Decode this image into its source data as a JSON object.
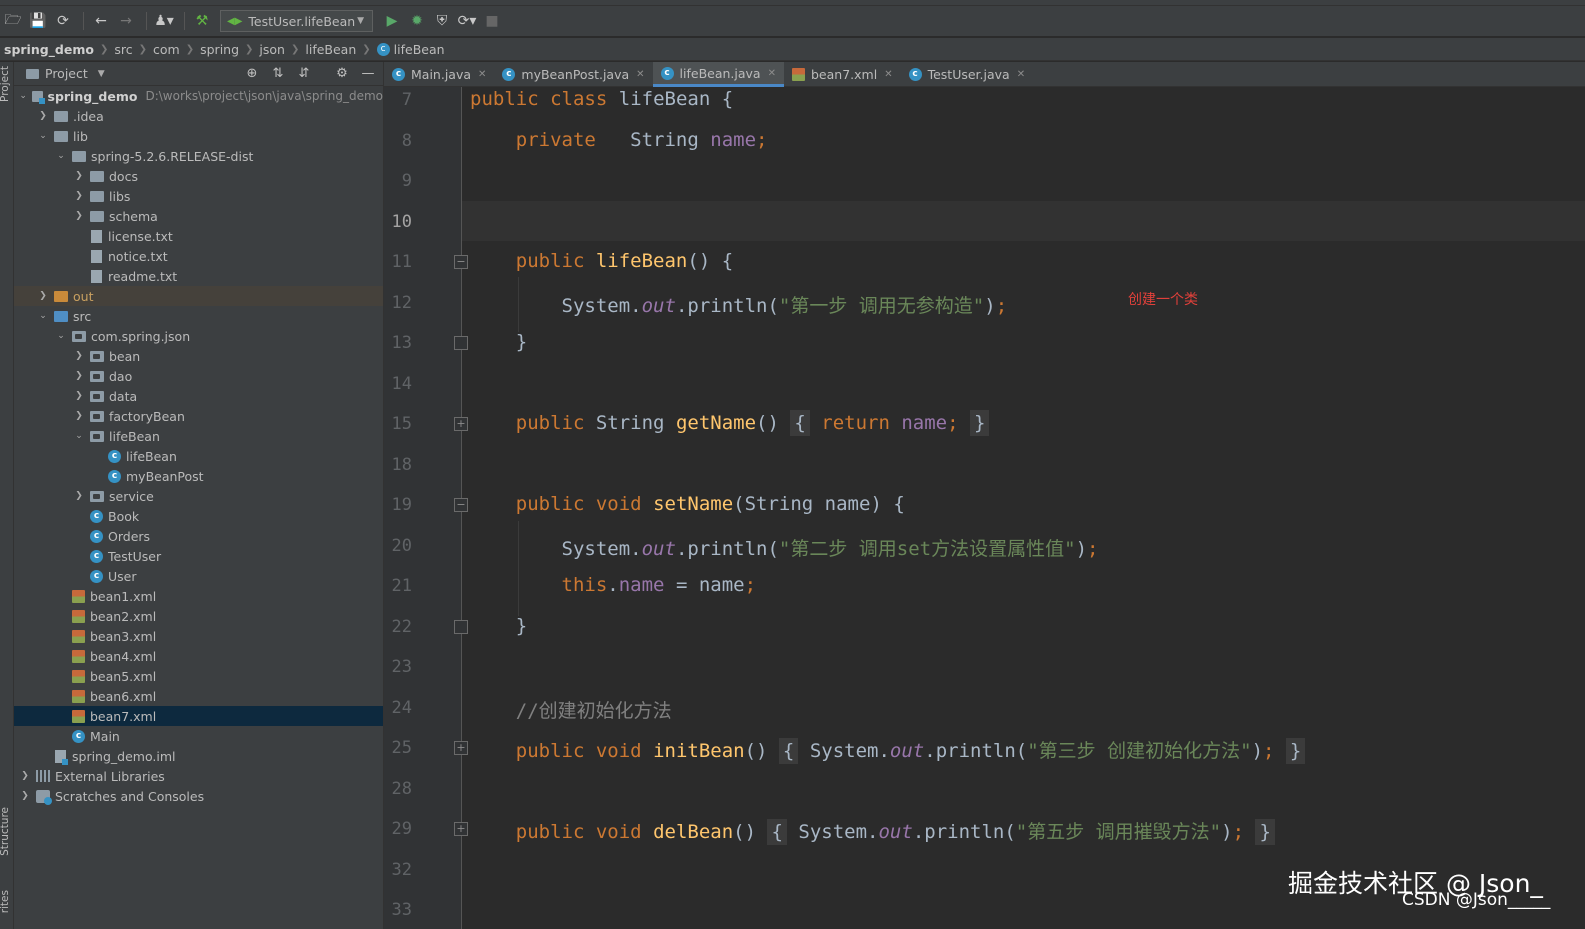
{
  "toolbar": {
    "run_config": "TestUser.lifeBean"
  },
  "breadcrumb": [
    "spring_demo",
    "src",
    "com",
    "spring",
    "json",
    "lifeBean",
    "lifeBean"
  ],
  "left_strip": {
    "project": "Project",
    "structure": "Structure",
    "favorites": "rites"
  },
  "project_panel": {
    "title": "Project",
    "tree": [
      {
        "label": "spring_demo",
        "path": "D:\\works\\project\\json\\java\\spring_demo"
      },
      {
        "label": ".idea"
      },
      {
        "label": "lib"
      },
      {
        "label": "spring-5.2.6.RELEASE-dist"
      },
      {
        "label": "docs"
      },
      {
        "label": "libs"
      },
      {
        "label": "schema"
      },
      {
        "label": "license.txt"
      },
      {
        "label": "notice.txt"
      },
      {
        "label": "readme.txt"
      },
      {
        "label": "out"
      },
      {
        "label": "src"
      },
      {
        "label": "com.spring.json"
      },
      {
        "label": "bean"
      },
      {
        "label": "dao"
      },
      {
        "label": "data"
      },
      {
        "label": "factoryBean"
      },
      {
        "label": "lifeBean"
      },
      {
        "label": "lifeBean"
      },
      {
        "label": "myBeanPost"
      },
      {
        "label": "service"
      },
      {
        "label": "Book"
      },
      {
        "label": "Orders"
      },
      {
        "label": "TestUser"
      },
      {
        "label": "User"
      },
      {
        "label": "bean1.xml"
      },
      {
        "label": "bean2.xml"
      },
      {
        "label": "bean3.xml"
      },
      {
        "label": "bean4.xml"
      },
      {
        "label": "bean5.xml"
      },
      {
        "label": "bean6.xml"
      },
      {
        "label": "bean7.xml"
      },
      {
        "label": "Main"
      },
      {
        "label": "spring_demo.iml"
      },
      {
        "label": "External Libraries"
      },
      {
        "label": "Scratches and Consoles"
      }
    ]
  },
  "tabs": [
    {
      "label": "Main.java"
    },
    {
      "label": "myBeanPost.java"
    },
    {
      "label": "lifeBean.java"
    },
    {
      "label": "bean7.xml"
    },
    {
      "label": "TestUser.java"
    }
  ],
  "editor": {
    "line_numbers": [
      "7",
      "8",
      "9",
      "10",
      "11",
      "12",
      "13",
      "14",
      "15",
      "18",
      "19",
      "20",
      "21",
      "22",
      "23",
      "24",
      "25",
      "28",
      "29",
      "32",
      "33"
    ],
    "kw_public": "public",
    "kw_class": "class",
    "kw_private": "private",
    "kw_return": "return",
    "kw_void": "void",
    "kw_this": "this",
    "class_name": "lifeBean",
    "type_string": "String",
    "field_name": "name",
    "system": "System",
    "out": "out",
    "println": "println",
    "getter": "getName",
    "setter": "setName",
    "init_method": "initBean",
    "destroy_method": "delBean",
    "str_step1": "\"第一步 调用无参构造\"",
    "str_step2": "\"第二步 调用set方法设置属性值\"",
    "str_step3": "\"第三步 创建初始化方法\"",
    "str_step5": "\"第五步 调用摧毁方法\"",
    "comment_init": "//创建初始化方法",
    "param": "String name"
  },
  "annotation": "创建一个类",
  "watermark": {
    "main": "掘金技术社区 @ Json_",
    "sub": "CSDN @Json_____"
  }
}
